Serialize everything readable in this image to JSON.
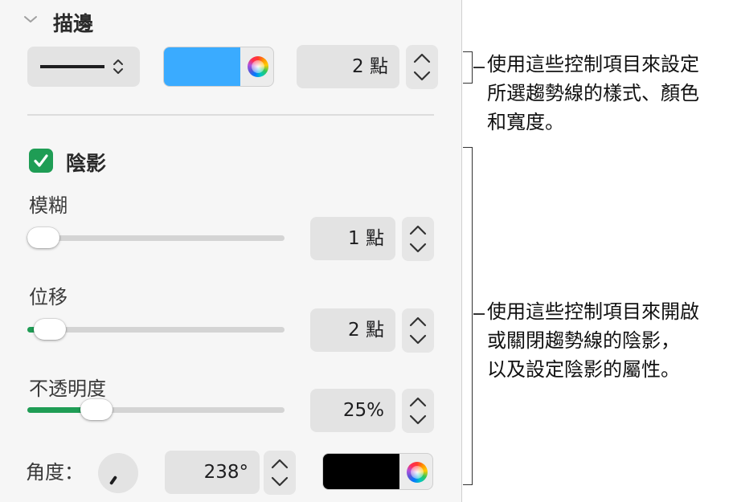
{
  "stroke": {
    "title": "描邊",
    "width_value": "2 點",
    "color": "#3aabff"
  },
  "shadow": {
    "title": "陰影",
    "checked": true,
    "blur": {
      "label": "模糊",
      "value": "1 點",
      "level": 0.03
    },
    "offset": {
      "label": "位移",
      "value": "2 點",
      "level": 0.07
    },
    "opacity": {
      "label": "不透明度",
      "value": "25%",
      "level": 0.25
    },
    "angle": {
      "label": "角度：",
      "value": "238°"
    },
    "color": "#000000"
  },
  "callouts": {
    "stroke_line1": "使用這些控制項目來設定",
    "stroke_line2": "所選趨勢線的樣式、顏色",
    "stroke_line3": "和寬度。",
    "shadow_line1": "使用這些控制項目來開啟",
    "shadow_line2": "或關閉趨勢線的陰影，",
    "shadow_line3": "以及設定陰影的屬性。"
  },
  "colors": {
    "accent_green": "#1f9d55",
    "stroke_blue": "#3aabff"
  }
}
